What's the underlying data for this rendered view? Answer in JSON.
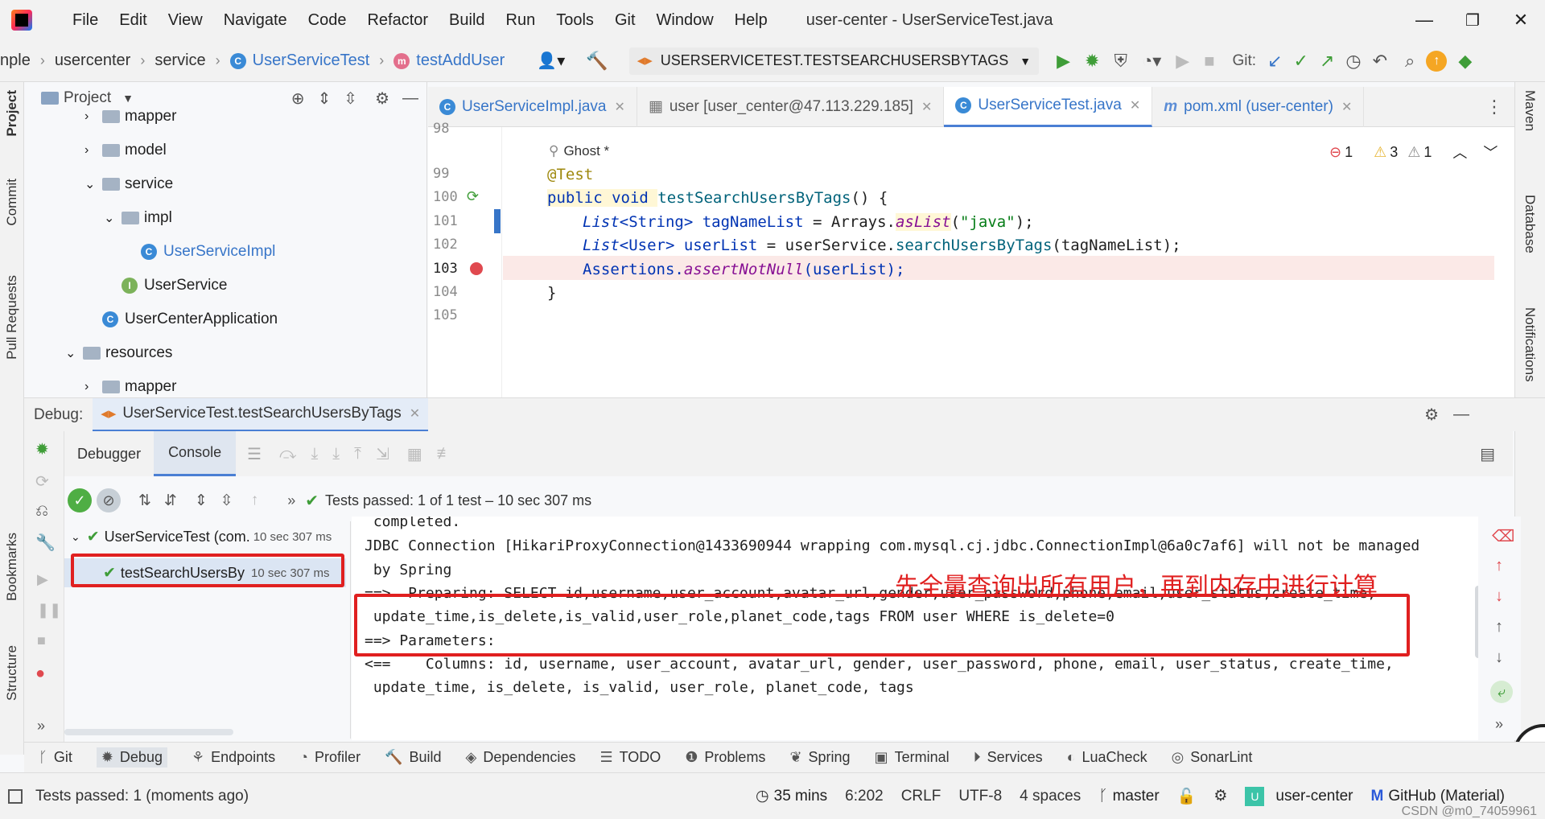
{
  "window": {
    "title": "user-center - UserServiceTest.java",
    "menu": [
      "File",
      "Edit",
      "View",
      "Navigate",
      "Code",
      "Refactor",
      "Build",
      "Run",
      "Tools",
      "Git",
      "Window",
      "Help"
    ]
  },
  "nav": {
    "crumbs": [
      "nple",
      "usercenter",
      "service",
      "UserServiceTest",
      "testAddUser"
    ],
    "run_config": "USERSERVICETEST.TESTSEARCHUSERSBYTAGS",
    "git_label": "Git:"
  },
  "left_strip": [
    "Project",
    "Commit",
    "Pull Requests",
    "Bookmarks",
    "Structure"
  ],
  "right_strip": [
    "Maven",
    "Database",
    "Notifications"
  ],
  "project": {
    "header": "Project",
    "tree": [
      {
        "label": "mapper",
        "kind": "folder",
        "indent": 1,
        "arrow": "›"
      },
      {
        "label": "model",
        "kind": "folder",
        "indent": 1,
        "arrow": "›"
      },
      {
        "label": "service",
        "kind": "folder",
        "indent": 1,
        "arrow": "⌄"
      },
      {
        "label": "impl",
        "kind": "folder",
        "indent": 2,
        "arrow": "⌄"
      },
      {
        "label": "UserServiceImpl",
        "kind": "class",
        "indent": 3,
        "arrow": ""
      },
      {
        "label": "UserService",
        "kind": "interface",
        "indent": 2,
        "arrow": ""
      },
      {
        "label": "UserCenterApplication",
        "kind": "class",
        "indent": 1,
        "arrow": ""
      },
      {
        "label": "resources",
        "kind": "folder",
        "indent": 0,
        "arrow": "⌄"
      },
      {
        "label": "mapper",
        "kind": "folder",
        "indent": 1,
        "arrow": "›"
      }
    ]
  },
  "editor": {
    "tabs": [
      {
        "label": "UserServiceImpl.java",
        "active": false
      },
      {
        "label": "user [user_center@47.113.229.185]",
        "active": false
      },
      {
        "label": "UserServiceTest.java",
        "active": true
      },
      {
        "label": "pom.xml (user-center)",
        "active": false
      }
    ],
    "inspections": {
      "errors": "1",
      "warnings": "3",
      "weak": "1"
    },
    "author": "Ghost *",
    "line_numbers": [
      "98",
      "99",
      "100",
      "101",
      "102",
      "103",
      "104",
      "105"
    ],
    "lines": {
      "l99": "@Test",
      "l100_kw": "public void ",
      "l100_fn": "testSearchUsersByTags",
      "l100_rest": "() {",
      "l101_a": "List",
      "l101_b": "<String> ",
      "l101_c": "tagNameList",
      "l101_d": " = Arrays.",
      "l101_e": "asList",
      "l101_f": "(",
      "l101_g": "\"java\"",
      "l101_h": ");",
      "l102_a": "List",
      "l102_b": "<User> ",
      "l102_c": "userList",
      "l102_d": " = userService.",
      "l102_e": "searchUsersByTags",
      "l102_f": "(tagNameList);",
      "l103_a": "Assertions.",
      "l103_b": "assertNotNull",
      "l103_c": "(userList);",
      "l104": "}"
    }
  },
  "debug": {
    "label": "Debug:",
    "session_tab": "UserServiceTest.testSearchUsersByTags",
    "tabs": [
      "Debugger",
      "Console"
    ],
    "status": "Tests passed: 1 of 1 test – 10 sec 307 ms",
    "tests": [
      {
        "name": "UserServiceTest (com.",
        "time": "10 sec 307 ms"
      },
      {
        "name": "testSearchUsersBy",
        "time": "10 sec 307 ms"
      }
    ],
    "console_lines": [
      " completed.",
      "JDBC Connection [HikariProxyConnection@1433690944 wrapping com.mysql.cj.jdbc.ConnectionImpl@6a0c7af6] will not be managed",
      " by Spring",
      "==>  Preparing: SELECT id,username,user_account,avatar_url,gender,user_password,phone,email,user_status,create_time,",
      " update_time,is_delete,is_valid,user_role,planet_code,tags FROM user WHERE is_delete=0",
      "==> Parameters: ",
      "<==    Columns: id, username, user_account, avatar_url, gender, user_password, phone, email, user_status, create_time,",
      " update_time, is_delete, is_valid, user_role, planet_code, tags"
    ],
    "annotation": "先全量查询出所有用户，再到内存中进行计算"
  },
  "bottom_tools": [
    "Git",
    "Debug",
    "Endpoints",
    "Profiler",
    "Build",
    "Dependencies",
    "TODO",
    "Problems",
    "Spring",
    "Terminal",
    "Services",
    "LuaCheck",
    "SonarLint"
  ],
  "status": {
    "left": "Tests passed: 1 (moments ago)",
    "time": "35 mins",
    "pos": "6:202",
    "eol": "CRLF",
    "enc": "UTF-8",
    "indent": "4 spaces",
    "branch": "master",
    "project": "user-center",
    "theme": "GitHub (Material)",
    "watermark": "CSDN @m0_74059961"
  },
  "colors": {
    "accent": "#3775c8",
    "annotation_red": "#e02020",
    "pass_green": "#3f9d38"
  }
}
